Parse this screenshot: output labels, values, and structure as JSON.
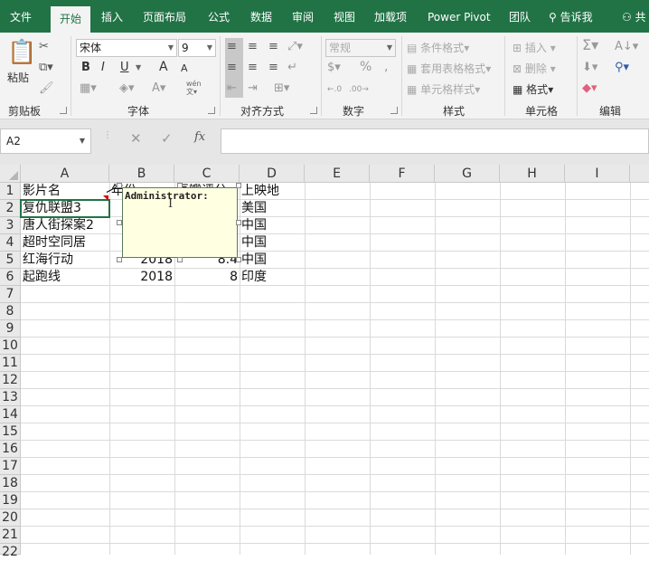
{
  "tabs": [
    "文件",
    "开始",
    "插入",
    "页面布局",
    "公式",
    "数据",
    "审阅",
    "视图",
    "加载项",
    "Power Pivot",
    "团队"
  ],
  "tell_me": "告诉我",
  "share": "共",
  "ribbon": {
    "clipboard": {
      "paste": "粘贴",
      "label": "剪贴板"
    },
    "font": {
      "name": "宋体",
      "size": "9",
      "label": "字体",
      "bold": "B",
      "italic": "I",
      "underline": "U",
      "grow": "A",
      "shrink": "A",
      "phonetic": "wén",
      "font_color": "A"
    },
    "alignment": {
      "label": "对齐方式"
    },
    "number": {
      "format": "常规",
      "label": "数字",
      "percent": "%",
      "comma": ","
    },
    "styles": {
      "conditional": "条件格式",
      "table": "套用表格格式",
      "cell": "单元格样式",
      "label": "样式"
    },
    "cells": {
      "insert": "插入",
      "delete": "删除",
      "format": "格式",
      "label": "单元格"
    },
    "editing": {
      "label": "编辑"
    }
  },
  "formula_bar": {
    "name_box": "A2",
    "fx": "fx",
    "value": ""
  },
  "columns": [
    "A",
    "B",
    "C",
    "D",
    "E",
    "F",
    "G",
    "H",
    "I"
  ],
  "rows": [
    "1",
    "2",
    "3",
    "4",
    "5",
    "6",
    "7",
    "8",
    "9",
    "10",
    "11",
    "12",
    "13",
    "14",
    "15",
    "16",
    "17",
    "18",
    "19",
    "20",
    "21",
    "22"
  ],
  "cells": {
    "A1": "影片名",
    "B1": "年份",
    "C1": "豆瓣评分",
    "D1": "上映地",
    "A2": "复仇联盟3",
    "D2": "美国",
    "A3": "唐人街探案2",
    "D3": "中国",
    "A4": "超时空同居",
    "D4": "中国",
    "A5": "红海行动",
    "B5": "2018",
    "C5": "8.4",
    "D5": "中国",
    "A6": "起跑线",
    "B6": "2018",
    "C6": "8",
    "D6": "印度"
  },
  "comment": {
    "author": "Administrator:"
  },
  "colors": {
    "brand": "#217346",
    "comment_bg": "#ffffe1"
  }
}
